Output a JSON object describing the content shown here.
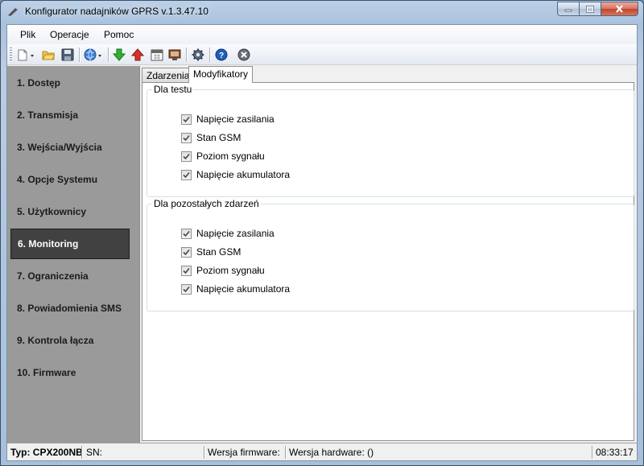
{
  "window": {
    "title": "Konfigurator nadajników GPRS v.1.3.47.10"
  },
  "menu": [
    {
      "label": "Plik"
    },
    {
      "label": "Operacje"
    },
    {
      "label": "Pomoc"
    }
  ],
  "toolbar": {
    "icons": [
      "new-file-icon",
      "open-folder-icon",
      "save-disk-icon",
      "globe-icon",
      "download-arrow-icon",
      "upload-arrow-icon",
      "calendar-icon",
      "monitor-icon",
      "settings-gear-icon",
      "help-icon",
      "exit-icon"
    ],
    "colors": {
      "download": "#2fb12f",
      "upload": "#d8322a",
      "help": "#1c5fbd"
    }
  },
  "sidebar": {
    "items": [
      {
        "label": "1. Dostęp"
      },
      {
        "label": "2. Transmisja"
      },
      {
        "label": "3. Wejścia/Wyjścia"
      },
      {
        "label": "4. Opcje Systemu"
      },
      {
        "label": "5. Użytkownicy"
      },
      {
        "label": "6. Monitoring",
        "active": true
      },
      {
        "label": "7. Ograniczenia"
      },
      {
        "label": "8. Powiadomienia SMS"
      },
      {
        "label": "9. Kontrola łącza"
      },
      {
        "label": "10. Firmware"
      }
    ]
  },
  "tabs": [
    {
      "label": "Zdarzenia"
    },
    {
      "label": "Modyfikatory",
      "active": true
    }
  ],
  "groups": [
    {
      "legend": "Dla testu",
      "options": [
        {
          "label": "Napięcie zasilania",
          "checked": true
        },
        {
          "label": "Stan GSM",
          "checked": true
        },
        {
          "label": "Poziom sygnału",
          "checked": true
        },
        {
          "label": "Napięcie akumulatora",
          "checked": true
        }
      ]
    },
    {
      "legend": "Dla pozostałych zdarzeń",
      "options": [
        {
          "label": "Napięcie zasilania",
          "checked": true
        },
        {
          "label": "Stan GSM",
          "checked": true
        },
        {
          "label": "Poziom sygnału",
          "checked": true
        },
        {
          "label": "Napięcie akumulatora",
          "checked": true
        }
      ]
    }
  ],
  "status": {
    "type": "Typ: CPX200NB",
    "sn": "SN:",
    "firmware": "Wersja firmware:",
    "hardware": "Wersja hardware: ()",
    "time": "08:33:17"
  }
}
